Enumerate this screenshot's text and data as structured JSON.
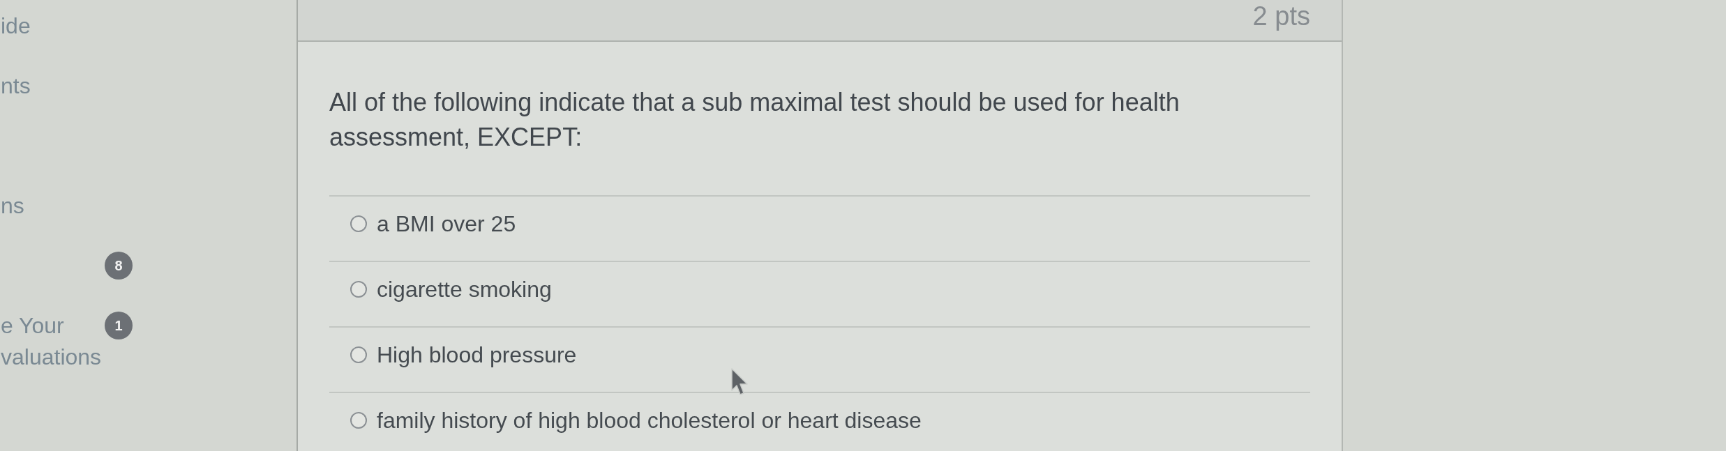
{
  "sidebar": {
    "items": [
      {
        "label": "ide"
      },
      {
        "label": "nts"
      },
      {
        "label": "ns"
      },
      {
        "badge": "8"
      },
      {
        "label": "e Your valuations",
        "badge": "1"
      }
    ]
  },
  "question": {
    "points": "2 pts",
    "text": "All of the following indicate that a sub maximal test should be used for health assessment, EXCEPT:",
    "answers": [
      {
        "label": "a BMI over 25",
        "selected": false
      },
      {
        "label": "cigarette smoking",
        "selected": false
      },
      {
        "label": "High blood pressure",
        "selected": false
      },
      {
        "label": "family history of high blood cholesterol or heart disease",
        "selected": false
      }
    ]
  }
}
